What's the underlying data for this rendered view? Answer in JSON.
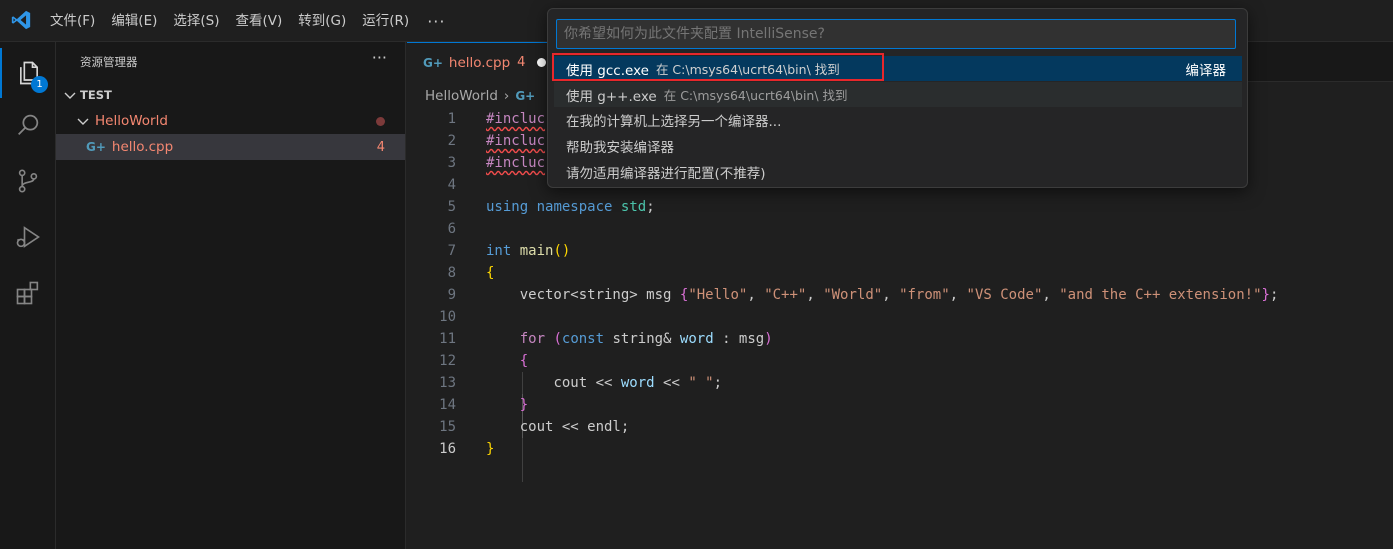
{
  "menu": {
    "items": [
      "文件(F)",
      "编辑(E)",
      "选择(S)",
      "查看(V)",
      "转到(G)",
      "运行(R)"
    ],
    "more": "···"
  },
  "activity": {
    "explorer_badge": "1"
  },
  "sidebar": {
    "title": "资源管理器",
    "more": "···",
    "root": "TEST",
    "folder": "HelloWorld",
    "file": "hello.cpp",
    "file_problems": "4"
  },
  "editor": {
    "tab_label": "hello.cpp",
    "tab_problems": "4",
    "breadcrumb_folder": "HelloWorld",
    "breadcrumb_sep": "›",
    "current_line": 16,
    "lines": [
      "1",
      "2",
      "3",
      "4",
      "5",
      "6",
      "7",
      "8",
      "9",
      "10",
      "11",
      "12",
      "13",
      "14",
      "15",
      "16"
    ]
  },
  "quickpick": {
    "placeholder": "你希望如何为此文件夹配置 IntelliSense?",
    "items": [
      {
        "label": "使用 gcc.exe",
        "description": "在 C:\\msys64\\ucrt64\\bin\\ 找到",
        "tag": "编译器"
      },
      {
        "label": "使用 g++.exe",
        "description": "在 C:\\msys64\\ucrt64\\bin\\ 找到"
      },
      {
        "label": "在我的计算机上选择另一个编译器..."
      },
      {
        "label": "帮助我安装编译器"
      },
      {
        "label": "请勿适用编译器进行配置(不推荐)"
      }
    ]
  },
  "colors": {
    "accent": "#0078d4",
    "error": "#f48771",
    "highlight_box": "#e8272b",
    "focused_item": "#04395e"
  }
}
